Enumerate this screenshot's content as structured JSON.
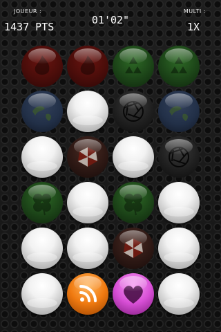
{
  "hud": {
    "player_label": "JOUEUR :",
    "score": "1437 PTS",
    "timer": "01'02\"",
    "multi_label": "MULTI :",
    "multi_value": "1X"
  },
  "grid": {
    "rows": 6,
    "cols": 4,
    "cells": [
      [
        "fire-red-dim",
        "fire-red-dim",
        "recycle-green-dim",
        "recycle-green-dim"
      ],
      [
        "earth-dim",
        "white",
        "shutter-dim",
        "earth-dim"
      ],
      [
        "white",
        "umbrella-dim",
        "white",
        "shutter-dim"
      ],
      [
        "clover-green-dim",
        "white",
        "clover-green-dim",
        "white"
      ],
      [
        "white",
        "white",
        "umbrella-dim",
        "white"
      ],
      [
        "white",
        "rss-orange",
        "heart-purple",
        "white"
      ]
    ]
  }
}
